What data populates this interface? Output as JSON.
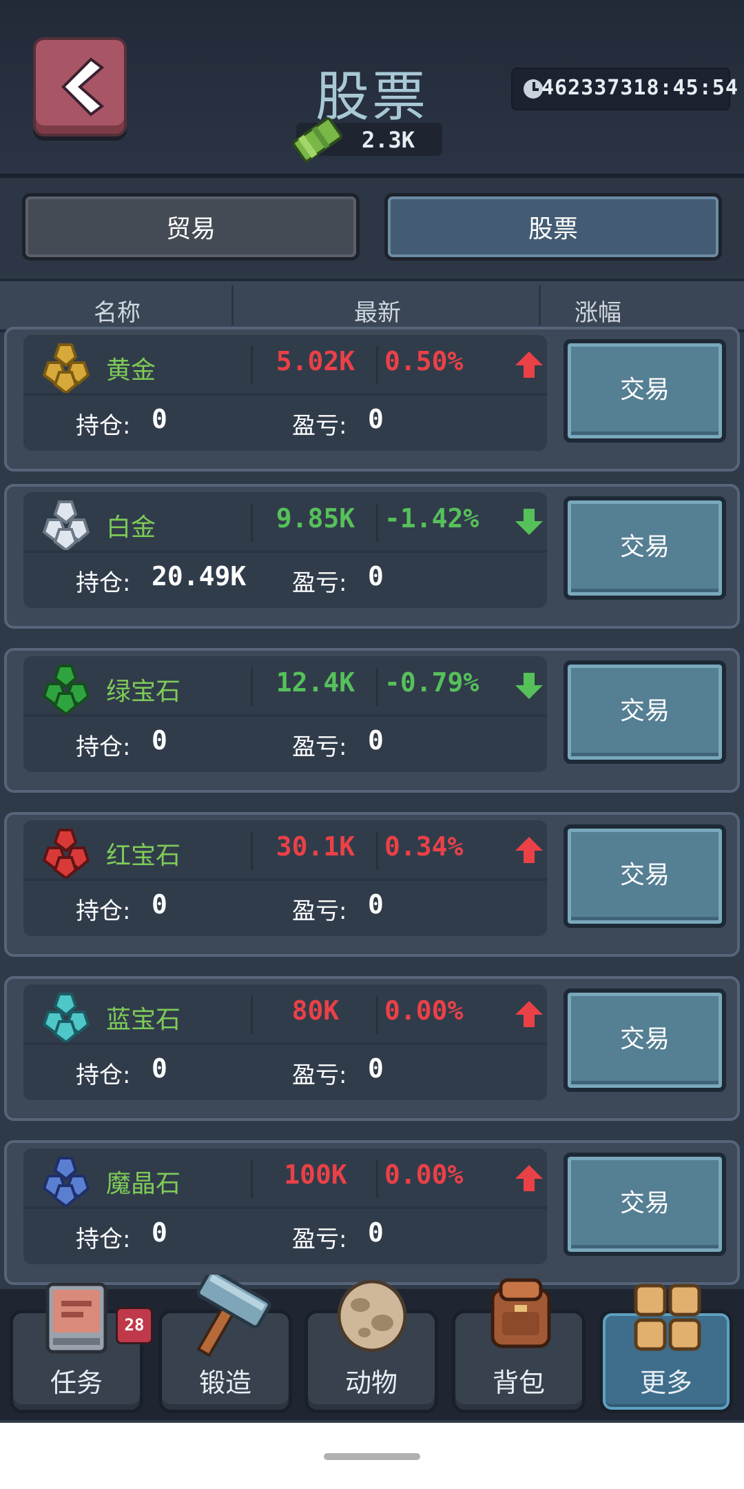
{
  "header": {
    "title": "股票",
    "money": "2.3K",
    "timer": "462337318:45:54"
  },
  "tabs": [
    {
      "label": "贸易"
    },
    {
      "label": "股票"
    }
  ],
  "columns": [
    "名称",
    "最新",
    "涨幅"
  ],
  "holding_label": "持仓:",
  "pnl_label": "盈亏:",
  "trade_label": "交易",
  "stocks": [
    {
      "name": "黄金",
      "price": "5.02K",
      "change": "0.50%",
      "direction": "up",
      "holding": "0",
      "pnl": "0"
    },
    {
      "name": "白金",
      "price": "9.85K",
      "change": "-1.42%",
      "direction": "down",
      "holding": "20.49K",
      "pnl": "0"
    },
    {
      "name": "绿宝石",
      "price": "12.4K",
      "change": "-0.79%",
      "direction": "down",
      "holding": "0",
      "pnl": "0"
    },
    {
      "name": "红宝石",
      "price": "30.1K",
      "change": "0.34%",
      "direction": "up",
      "holding": "0",
      "pnl": "0"
    },
    {
      "name": "蓝宝石",
      "price": "80K",
      "change": "0.00%",
      "direction": "up",
      "holding": "0",
      "pnl": "0"
    },
    {
      "name": "魔晶石",
      "price": "100K",
      "change": "0.00%",
      "direction": "up",
      "holding": "0",
      "pnl": "0"
    }
  ],
  "nav": [
    {
      "label": "任务",
      "icon": "task-book-icon",
      "badge": "28"
    },
    {
      "label": "锻造",
      "icon": "hammer-icon"
    },
    {
      "label": "动物",
      "icon": "egg-icon"
    },
    {
      "label": "背包",
      "icon": "backpack-icon"
    },
    {
      "label": "更多",
      "icon": "more-grid-icon",
      "active": true
    }
  ],
  "colors": {
    "up": "#ea4147",
    "down": "#56c15a",
    "gold": "#d6a93a",
    "platinum": "#dfe6ee",
    "emerald": "#2fa33f",
    "ruby": "#d83a3a",
    "sapphire": "#4fc6c8",
    "crystal": "#5b7fd0"
  }
}
